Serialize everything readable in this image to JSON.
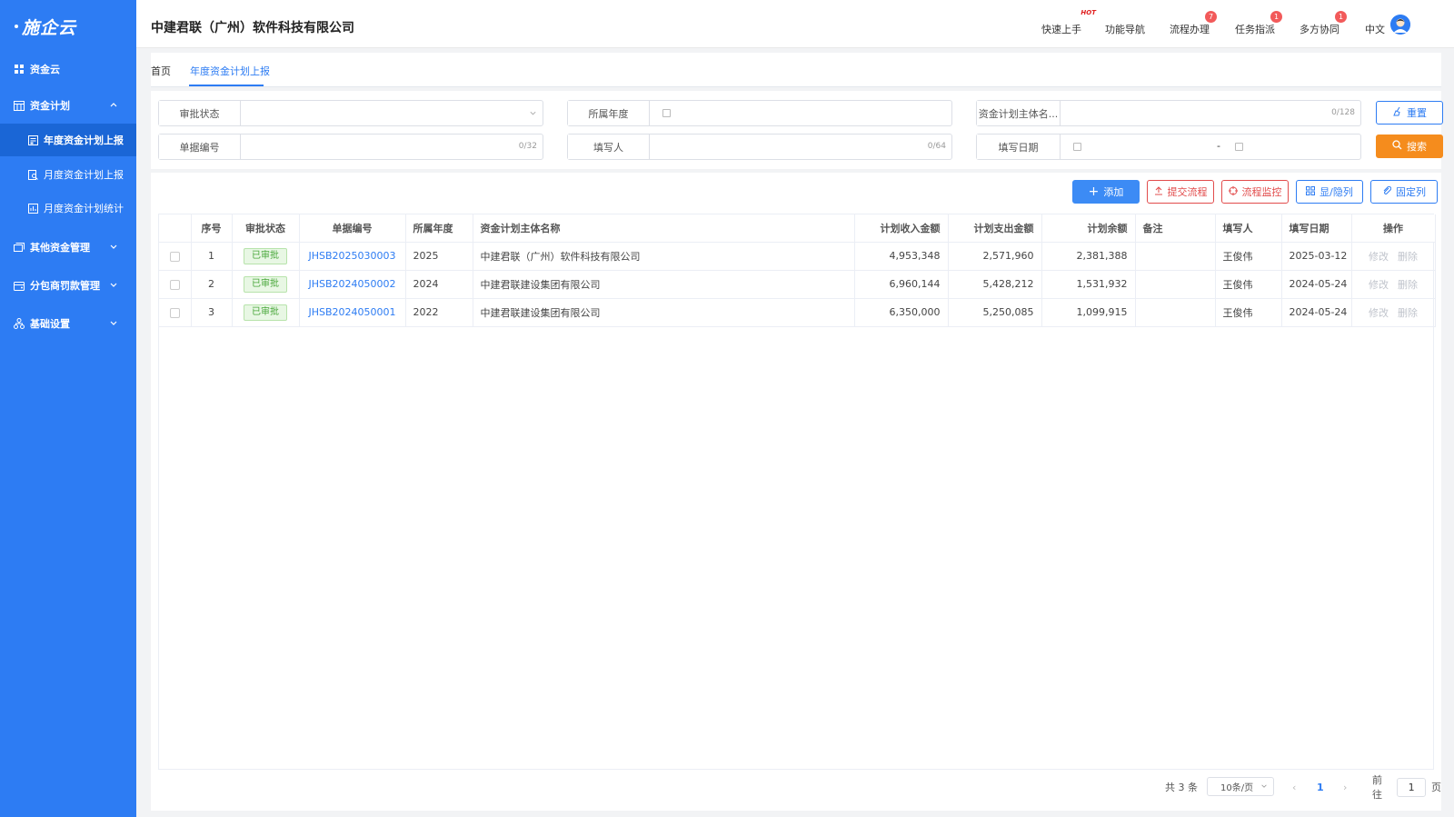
{
  "brand": {
    "logo_text": "施企云"
  },
  "sidebar": {
    "items": [
      {
        "label": "资金云"
      },
      {
        "label": "资金计划"
      },
      {
        "label": "年度资金计划上报"
      },
      {
        "label": "月度资金计划上报"
      },
      {
        "label": "月度资金计划统计"
      },
      {
        "label": "其他资金管理"
      },
      {
        "label": "分包商罚款管理"
      },
      {
        "label": "基础设置"
      }
    ]
  },
  "header": {
    "company": "中建君联（广州）软件科技有限公司",
    "nav": [
      {
        "label": "快速上手",
        "badge": "HOT"
      },
      {
        "label": "功能导航",
        "badge": ""
      },
      {
        "label": "流程办理",
        "badge": "7"
      },
      {
        "label": "任务指派",
        "badge": "1"
      },
      {
        "label": "多方协同",
        "badge": "1"
      }
    ],
    "language": "中文"
  },
  "tabs": [
    {
      "label": "首页"
    },
    {
      "label": "年度资金计划上报"
    }
  ],
  "filters": {
    "approval_status": {
      "label": "审批状态"
    },
    "year": {
      "label": "所属年度"
    },
    "subject_name": {
      "label": "资金计划主体名...",
      "count": "0/128"
    },
    "doc_no": {
      "label": "单据编号",
      "count": "0/32"
    },
    "filler": {
      "label": "填写人",
      "count": "0/64"
    },
    "fill_date": {
      "label": "填写日期",
      "separator": "-"
    },
    "reset_label": "重置",
    "search_label": "搜索"
  },
  "toolbar": {
    "add": "添加",
    "submit_flow": "提交流程",
    "flow_monitor": "流程监控",
    "show_hide_cols": "显/隐列",
    "fixed_cols": "固定列"
  },
  "table": {
    "columns": [
      "序号",
      "审批状态",
      "单据编号",
      "所属年度",
      "资金计划主体名称",
      "计划收入金额",
      "计划支出金额",
      "计划余额",
      "备注",
      "填写人",
      "填写日期",
      "操作"
    ],
    "rows": [
      {
        "no": "1",
        "status": "已审批",
        "doc_no": "JHSB2025030003",
        "year": "2025",
        "subject": "中建君联（广州）软件科技有限公司",
        "income": "4,953,348",
        "expense": "2,571,960",
        "balance": "2,381,388",
        "remark": "",
        "filler": "王俊伟",
        "date": "2025-03-12",
        "edit": "修改",
        "delete": "删除"
      },
      {
        "no": "2",
        "status": "已审批",
        "doc_no": "JHSB2024050002",
        "year": "2024",
        "subject": "中建君联建设集团有限公司",
        "income": "6,960,144",
        "expense": "5,428,212",
        "balance": "1,531,932",
        "remark": "",
        "filler": "王俊伟",
        "date": "2024-05-24",
        "edit": "修改",
        "delete": "删除"
      },
      {
        "no": "3",
        "status": "已审批",
        "doc_no": "JHSB2024050001",
        "year": "2022",
        "subject": "中建君联建设集团有限公司",
        "income": "6,350,000",
        "expense": "5,250,085",
        "balance": "1,099,915",
        "remark": "",
        "filler": "王俊伟",
        "date": "2024-05-24",
        "edit": "修改",
        "delete": "删除"
      }
    ]
  },
  "pagination": {
    "total_text": "共 3 条",
    "page_size": "10条/页",
    "current_page": "1",
    "goto_prefix": "前往",
    "goto_value": "1",
    "goto_suffix": "页"
  },
  "colors": {
    "sidebar_bg": "#2d7cf3",
    "primary": "#2d7cf3",
    "search": "#f58c1d",
    "danger": "#e24c4c",
    "approved": "#48a73a"
  }
}
